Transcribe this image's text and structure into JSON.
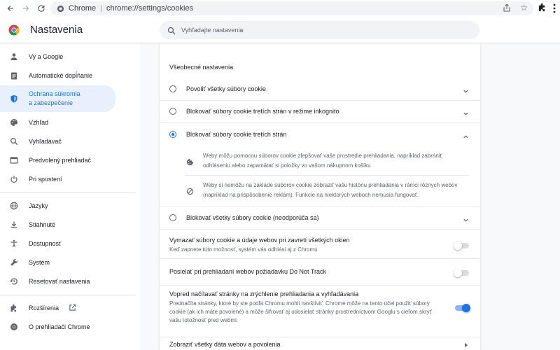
{
  "browser": {
    "omnibox_site": "Chrome",
    "omnibox_separator": "|",
    "omnibox_url": "chrome://settings/cookies"
  },
  "header": {
    "title": "Nastavenia",
    "search_placeholder": "Vyhľadajte nastavenia"
  },
  "sidebar": {
    "items": [
      {
        "label": "Vy a Google",
        "icon": "person-icon"
      },
      {
        "label": "Automatické dopĺňanie",
        "icon": "clipboard-icon"
      },
      {
        "label": "Ochrana súkromia a zabezpečenie",
        "icon": "shield-icon",
        "active": true
      },
      {
        "label": "Vzhľad",
        "icon": "palette-icon"
      },
      {
        "label": "Vyhľadávač",
        "icon": "search-icon"
      },
      {
        "label": "Predvolený prehliadač",
        "icon": "browser-icon"
      },
      {
        "label": "Pri spustení",
        "icon": "power-icon"
      },
      {
        "label": "Jazyky",
        "icon": "globe-icon"
      },
      {
        "label": "Stiahnuté",
        "icon": "download-icon"
      },
      {
        "label": "Dostupnosť",
        "icon": "accessibility-icon"
      },
      {
        "label": "Systém",
        "icon": "wrench-icon"
      },
      {
        "label": "Resetovať nastavenia",
        "icon": "history-icon"
      },
      {
        "label": "Rozšírenia",
        "icon": "puzzle-icon"
      },
      {
        "label": "O prehliadači Chrome",
        "icon": "chrome-icon"
      }
    ],
    "active_label_line1": "Ochrana súkromia",
    "active_label_line2": "a zabezpečenie"
  },
  "main": {
    "section_title": "Všeobecné nastavenia",
    "radios": [
      {
        "label": "Povoliť všetky súbory cookie",
        "checked": false,
        "expanded": false
      },
      {
        "label": "Blokovať súbory cookie tretích strán v režime inkognito",
        "checked": false,
        "expanded": false
      },
      {
        "label": "Blokovať súbory cookie tretích strán",
        "checked": true,
        "expanded": true
      },
      {
        "label": "Blokovať všetky súbory cookie (neodporúča sa)",
        "checked": false,
        "expanded": false
      }
    ],
    "details": [
      {
        "icon": "cookie-icon",
        "text": "Weby môžu pomocou súborov cookie zlepšovať vaše prostredie prehliadania, napríklad zabrániť odhláseniu alebo zapamätať si položky vo vašom nákupnom košíku"
      },
      {
        "icon": "block-icon",
        "text": "Weby si nemôžu na základe súborov cookie zobraziť vašu históriu prehliadania v rámci rôznych webov (napríklad na prispôsobenie reklám). Funkcie na niektorých weboch nemusia fungovať."
      }
    ],
    "toggles": [
      {
        "title": "Vymazať súbory cookie a údaje webov pri zavretí všetkých okien",
        "desc": "Keď zapnete túto možnosť, systém vás odhlási aj z Chromu",
        "on": false
      },
      {
        "title": "Posielať pri prehliadaní webov požiadavku Do Not Track",
        "desc": "",
        "on": false
      },
      {
        "title": "Vopred načítavať stránky na zrýchlenie prehliadania a vyhľadávania",
        "desc": "Prednačíta stránky, ktoré by ste podľa Chromu mohli navštíviť. Chrome môže na tento účel použiť súbory cookie (ak ich máte povolené) a môže šifrovať aj odosielať stránky prostredníctvom Googlu s cieľom skryť vašu totožnosť pred webmi.",
        "on": true
      }
    ],
    "link_label": "Zobraziť všetky dáta webov a povolenia"
  },
  "colors": {
    "accent": "#1a73e8",
    "active_bg": "#e8f0fe",
    "toggle_track_on": "#8ab4f8"
  }
}
